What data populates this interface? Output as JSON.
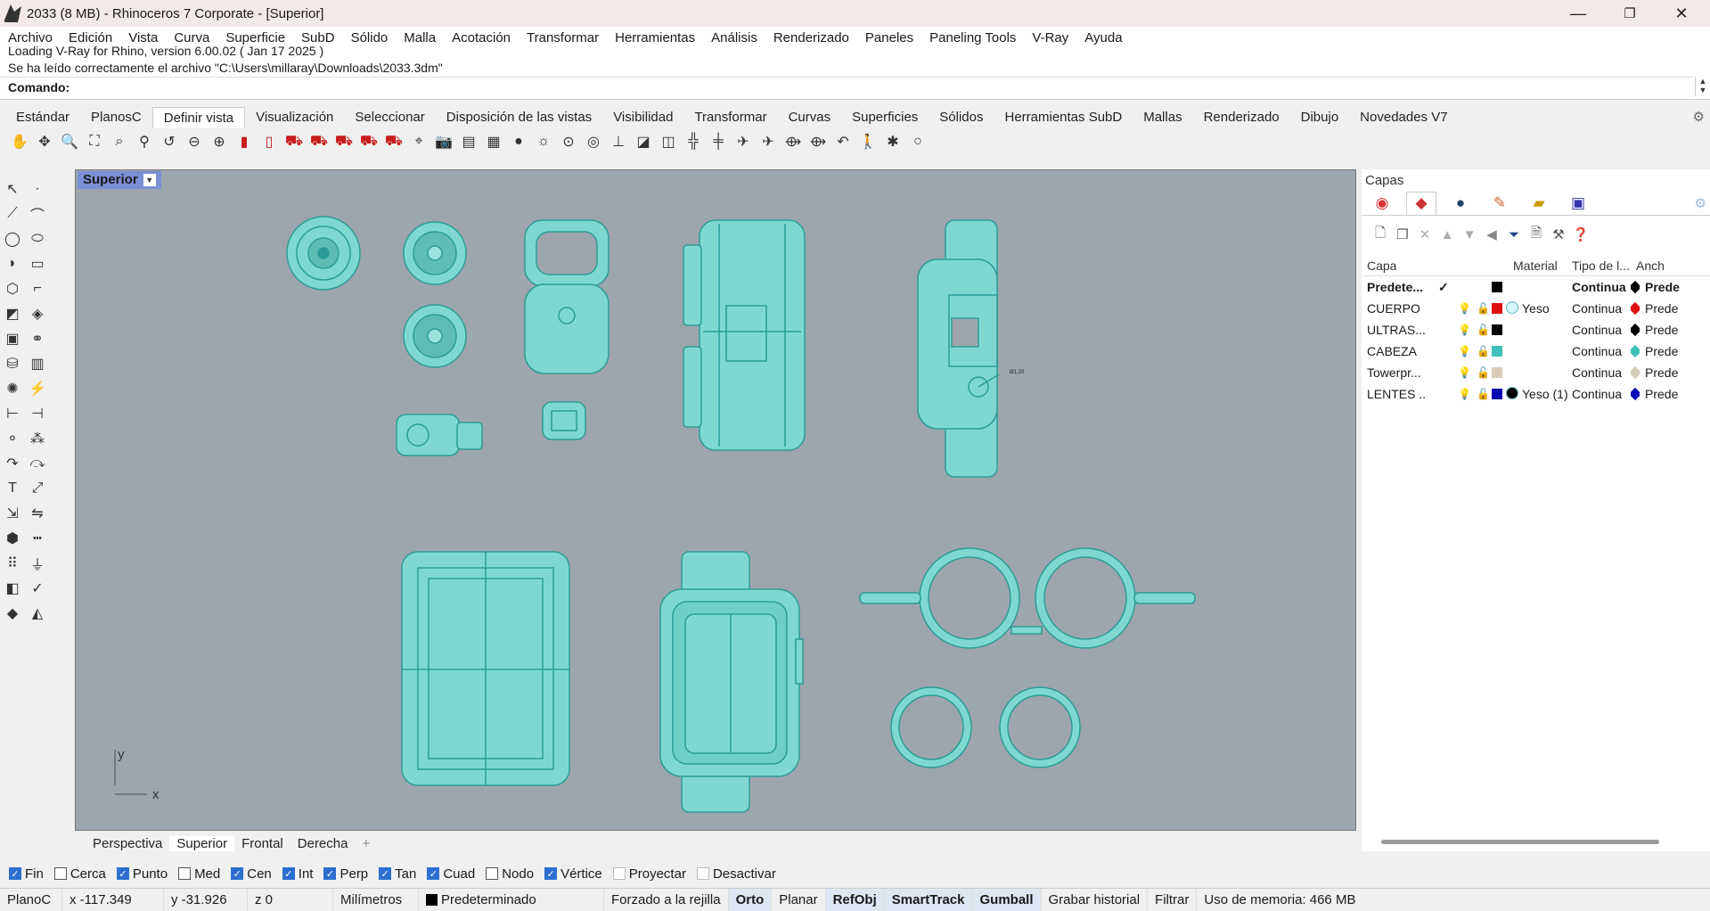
{
  "window": {
    "title": "2033 (8 MB) - Rhinoceros 7 Corporate - [Superior]",
    "min": "—",
    "max": "❐",
    "close": "✕"
  },
  "menu": [
    "Archivo",
    "Edición",
    "Vista",
    "Curva",
    "Superficie",
    "SubD",
    "Sólido",
    "Malla",
    "Acotación",
    "Transformar",
    "Herramientas",
    "Análisis",
    "Renderizado",
    "Paneles",
    "Paneling Tools",
    "V-Ray",
    "Ayuda"
  ],
  "history": [
    "Loading V-Ray for Rhino, version 6.00.02 ( Jan 17 2025 )",
    "Se ha leído correctamente el archivo \"C:\\Users\\millaray\\Downloads\\2033.3dm\""
  ],
  "command": {
    "label": "Comando:"
  },
  "tabs": [
    "Estándar",
    "PlanosC",
    "Definir vista",
    "Visualización",
    "Seleccionar",
    "Disposición de las vistas",
    "Visibilidad",
    "Transformar",
    "Curvas",
    "Superficies",
    "Sólidos",
    "Herramientas SubD",
    "Mallas",
    "Renderizado",
    "Dibujo",
    "Novedades V7"
  ],
  "tabs_active": "Definir vista",
  "toolbar_icons": [
    "pan-icon",
    "rotate-icon",
    "zoom-icon",
    "zoom-extents-icon",
    "zoom-window-icon",
    "zoom-selected-icon",
    "undo-view-icon",
    "zoom-out-icon",
    "zoom-1to1-icon",
    "viewport-red-icon",
    "viewport-red2-icon",
    "car-red-icon",
    "car-red2-icon",
    "car-red3-icon",
    "car-red4-icon",
    "car-red5-icon",
    "camera-tool-icon",
    "camera-icon",
    "film-icon",
    "printer-icon",
    "sphere-icon",
    "lamp-icon",
    "target-icon",
    "target2-icon",
    "axis-icon",
    "plane-icon",
    "box-icon",
    "crosshair-icon",
    "crosshair2-icon",
    "plane-fly-icon",
    "plane-fly2-icon",
    "spaceship-icon",
    "spaceship2-icon",
    "undo-arrow-icon",
    "walk-icon",
    "sun-icon",
    "circle-icon"
  ],
  "viewport": {
    "label": "Superior",
    "dim_text": "Ø1.20",
    "axis_x": "x",
    "axis_y": "y"
  },
  "view_tabs": [
    "Perspectiva",
    "Superior",
    "Frontal",
    "Derecha"
  ],
  "view_tabs_add": "+",
  "osnaps": [
    {
      "label": "Fin",
      "checked": true
    },
    {
      "label": "Cerca",
      "checked": false
    },
    {
      "label": "Punto",
      "checked": true
    },
    {
      "label": "Med",
      "checked": false
    },
    {
      "label": "Cen",
      "checked": true
    },
    {
      "label": "Int",
      "checked": true
    },
    {
      "label": "Perp",
      "checked": true
    },
    {
      "label": "Tan",
      "checked": true
    },
    {
      "label": "Cuad",
      "checked": true
    },
    {
      "label": "Nodo",
      "checked": false
    },
    {
      "label": "Vértice",
      "checked": true
    },
    {
      "label": "Proyectar",
      "checked": false
    },
    {
      "label": "Desactivar",
      "checked": false
    }
  ],
  "status": {
    "cplane": "PlanoC",
    "x": "x -117.349",
    "y": "y -31.926",
    "z": "z 0",
    "units": "Milímetros",
    "layer": "Predeterminado",
    "grid": "Forzado a la rejilla",
    "ortho": "Orto",
    "planar": "Planar",
    "osnap": "RefObj",
    "smarttrack": "SmartTrack",
    "gumball": "Gumball",
    "history": "Grabar historial",
    "filter": "Filtrar",
    "memory": "Uso de memoria: 466 MB"
  },
  "panel": {
    "title": "Capas",
    "headers": {
      "name": "Capa",
      "material": "Material",
      "linetype": "Tipo de l...",
      "width": "Anch"
    },
    "layers": [
      {
        "name": "Predete...",
        "current": "✓",
        "color": "#000000",
        "material": "",
        "linetype": "Continua",
        "width": "Prede",
        "bold": true
      },
      {
        "name": "CUERPO",
        "color": "#e01010",
        "material": "Yeso",
        "linetype": "Continua",
        "width": "Prede",
        "mat_color": "#d8f6ff",
        "print_color": "#e01010"
      },
      {
        "name": "ULTRAS...",
        "color": "#000000",
        "material": "",
        "linetype": "Continua",
        "width": "Prede",
        "print_color": "#000000"
      },
      {
        "name": "CABEZA",
        "color": "#3fc0b8",
        "material": "",
        "linetype": "Continua",
        "width": "Prede",
        "print_color": "#3fc0b8"
      },
      {
        "name": "Towerpr...",
        "color": "#d8ccb8",
        "material": "",
        "linetype": "Continua",
        "width": "Prede",
        "print_color": "#d8ccb8"
      },
      {
        "name": "LENTES ...",
        "color": "#0a0ab4",
        "material": "Yeso (1)",
        "linetype": "Continua",
        "width": "Prede",
        "mat_color": "#000000",
        "print_color": "#0a0ab4"
      }
    ]
  }
}
